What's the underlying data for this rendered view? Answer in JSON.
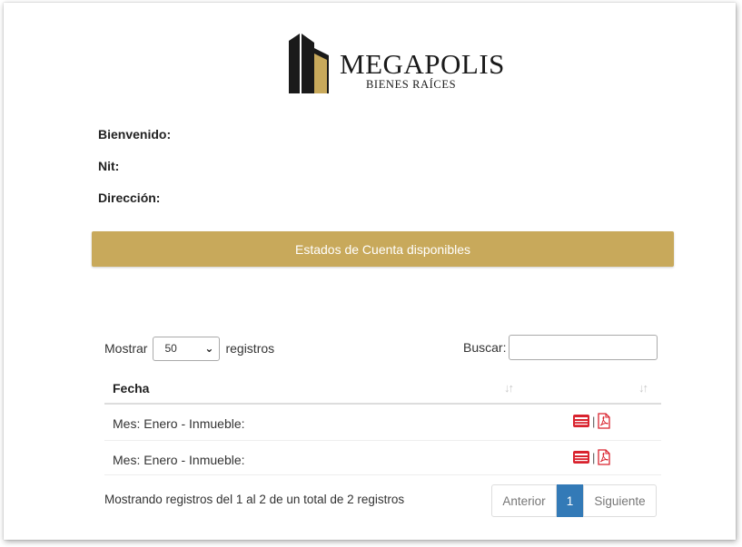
{
  "logo": {
    "name": "MEGAPOLIS",
    "subtitle": "BIENES RAÍCES"
  },
  "client_info": {
    "welcome_label": "Bienvenido:",
    "nit_label": "Nit:",
    "address_label": "Dirección:"
  },
  "banner": {
    "label": "Estados de Cuenta disponibles"
  },
  "table_controls": {
    "show_label": "Mostrar",
    "page_length": "50",
    "records_label": "registros",
    "search_label": "Buscar:",
    "search_value": ""
  },
  "table": {
    "columns": [
      "Fecha",
      "",
      ""
    ],
    "rows": [
      {
        "fecha": "Mes: Enero - Inmueble:",
        "separator": "|"
      },
      {
        "fecha": "Mes: Enero - Inmueble:",
        "separator": "|"
      }
    ]
  },
  "footer": {
    "info": "Mostrando registros del 1 al 2 de un total de 2 registros",
    "pagination": {
      "previous": "Anterior",
      "current": "1",
      "next": "Siguiente"
    }
  },
  "colors": {
    "gold": "#c8a95b",
    "pager_active": "#337ab7",
    "icon_red": "#d9232e"
  },
  "icons": {
    "row_actions": [
      "statement-card-icon",
      "pdf-icon"
    ],
    "sort": "sort-icon"
  }
}
